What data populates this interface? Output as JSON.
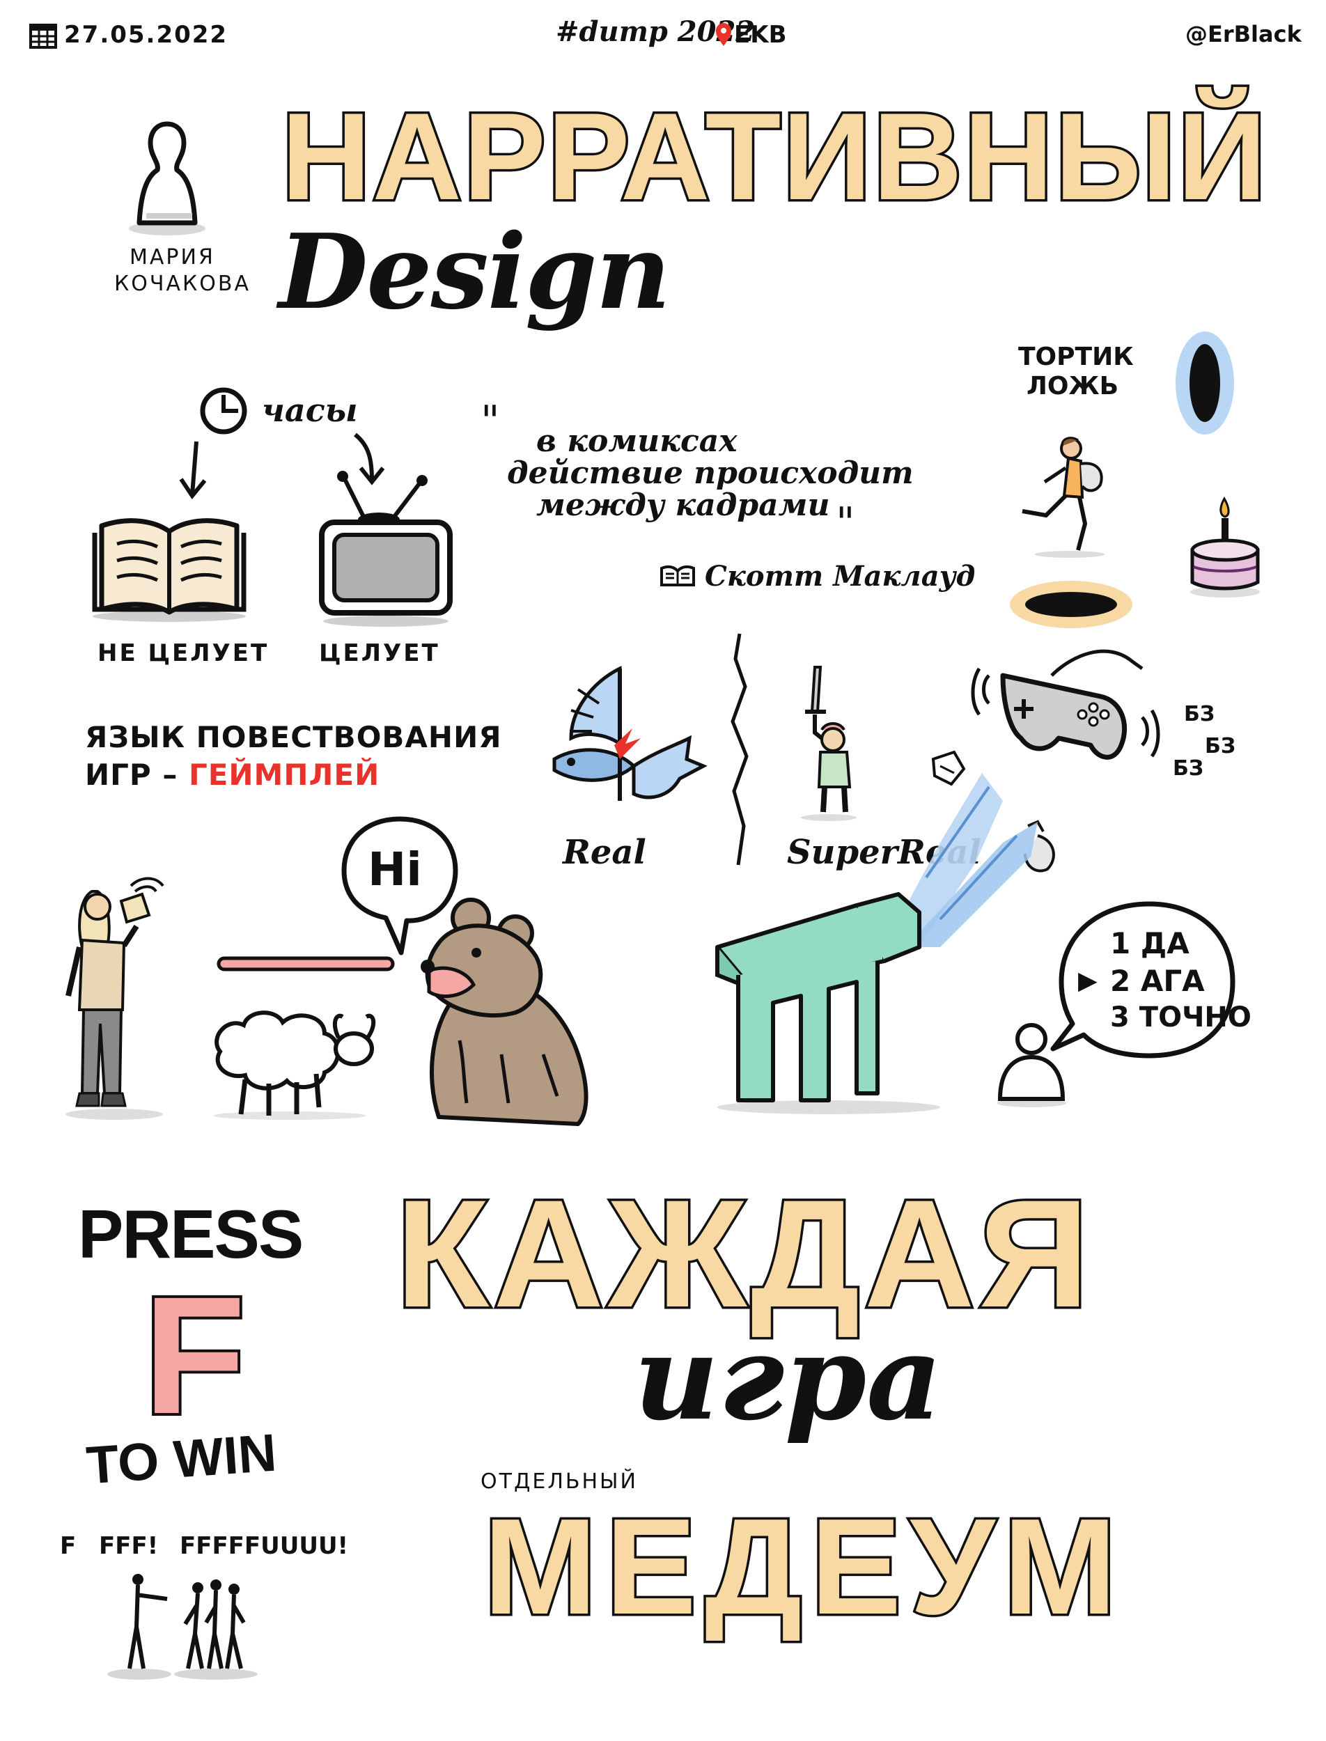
{
  "header": {
    "date": "27.05.2022",
    "event": "#dump 2022",
    "location": "EKB",
    "author": "@ErBlack"
  },
  "speaker": {
    "name_line1": "МАРИЯ",
    "name_line2": "КОЧАКОВА"
  },
  "title": {
    "main": "НАРРАТИВНЫЙ",
    "sub": "Design"
  },
  "time": {
    "label": "часы",
    "book_caption": "НЕ ЦЕЛУЕТ",
    "tv_caption": "ЦЕЛУЕТ"
  },
  "quote": {
    "open": "\"",
    "line1": "в комиксах",
    "line2": "действие происходит",
    "line3": "между кадрами",
    "close": "\"",
    "author": "Скотт Маклауд"
  },
  "portal": {
    "line1": "ТОРТИК",
    "line2": "ЛОЖЬ"
  },
  "gameplay": {
    "line1": "ЯЗЫК ПОВЕСТВОВАНИЯ",
    "line2_prefix": "ИГР –",
    "line2_accent": "ГЕЙМПЛЕЙ",
    "accent_color": "#e8322a"
  },
  "realism": {
    "real": "Real",
    "super_real": "SuperReal"
  },
  "controller": {
    "vibration": [
      "БЗ",
      "БЗ",
      "БЗ"
    ]
  },
  "speech": {
    "hi": "Hi"
  },
  "dialog": {
    "options": [
      {
        "num": "1",
        "text": "ДА",
        "selected": false
      },
      {
        "num": "2",
        "text": "АГА",
        "selected": true
      },
      {
        "num": "3",
        "text": "ТОЧНО",
        "selected": false
      }
    ],
    "selector": "▶"
  },
  "press": {
    "line1": "PRESS",
    "key": "F",
    "line3": "TO WIN",
    "shouts": [
      "F",
      "FFF!",
      "FFFFFUUUU!"
    ]
  },
  "conclusion": {
    "line1": "КАЖДАЯ",
    "line2": "игра",
    "small": "ОТДЕЛЬНЫЙ",
    "line3": "МЕДЕУМ"
  },
  "colors": {
    "accent_fill": "#f8d9a4",
    "red": "#e8322a",
    "teal": "#93dcc3",
    "blue": "#9ec6ef",
    "grey": "#b0b0b0",
    "brown": "#b39a82",
    "pink": "#f4a7a3",
    "cake_pink": "#e7c2dc"
  }
}
